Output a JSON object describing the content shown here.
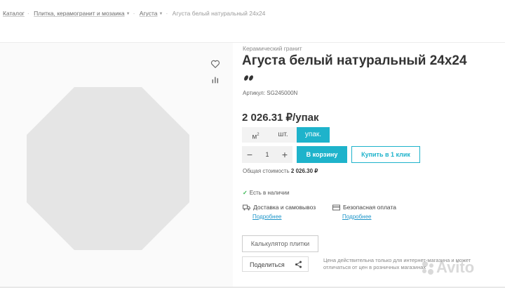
{
  "breadcrumb": {
    "catalog": "Каталог",
    "level1": "Плитка, керамогранит и мозаика",
    "level2": "Агуста",
    "current": "Агуста белый натуральный 24x24"
  },
  "product": {
    "category": "Керамический гранит",
    "title": "Агуста белый натуральный 24x24",
    "sku": "Артикул: SG245000N",
    "price": "2 026.31 ₽/упак"
  },
  "units": {
    "m2": "м",
    "m2_sup": "2",
    "pcs": "шт.",
    "pack": "упак."
  },
  "quantity": {
    "minus": "−",
    "value": "1",
    "plus": "+"
  },
  "buttons": {
    "cart": "В корзину",
    "one_click": "Купить в 1 клик",
    "calculator": "Калькулятор плитки",
    "share": "Поделиться"
  },
  "total": {
    "label": "Общая стоимость",
    "value": "2 026.30 ₽"
  },
  "stock": "Есть в наличии",
  "services": {
    "delivery": {
      "title": "Доставка и самовывоз",
      "link": "Подробнее"
    },
    "payment": {
      "title": "Безопасная оплата",
      "link": "Подробнее"
    }
  },
  "note": "Цена действительна только для интернет-магазина и может отличаться от цен в розничных магазинах",
  "watermark": "Avito",
  "colors": {
    "accent": "#1eb3cb",
    "link": "#1e95c9",
    "stock": "#2fb44a"
  }
}
